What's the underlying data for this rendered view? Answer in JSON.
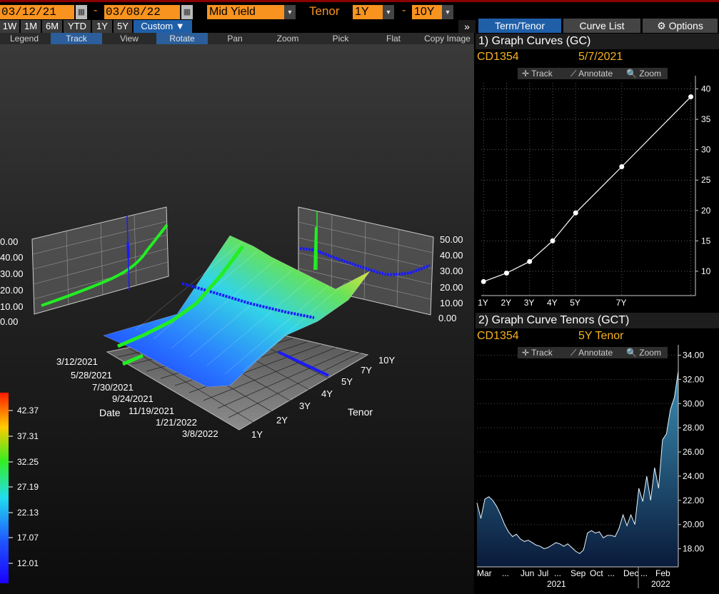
{
  "topbar": {
    "start_date": "03/12/21",
    "end_date": "03/08/22",
    "field": "Mid Yield",
    "tenor_label": "Tenor",
    "tenor_from": "1Y",
    "tenor_to": "10Y",
    "dash": "-",
    "calendar_icon": "calendar-icon",
    "dropdown_icon": "chevron-down-icon"
  },
  "periods": [
    "1W",
    "1M",
    "6M",
    "YTD",
    "1Y",
    "5Y",
    "Custom ▼"
  ],
  "toolbar": [
    "Legend",
    "Track",
    "View",
    "Rotate",
    "Pan",
    "Zoom",
    "Pick",
    "Flat",
    "Copy Image"
  ],
  "toolbar_active": [
    "Track",
    "Rotate"
  ],
  "collapse_label": "»",
  "right_tabs": [
    {
      "label": "Term/Tenor",
      "active": true
    },
    {
      "label": "Curve List",
      "active": false
    },
    {
      "label": "⚙ Options",
      "active": false
    }
  ],
  "gc": {
    "title": "1) Graph Curves (GC)",
    "ticker": "CD1354",
    "date": "5/7/2021",
    "tools": [
      "✛ Track",
      "⟋ Annotate",
      "🔍 Zoom"
    ],
    "chart_data": {
      "type": "line",
      "x": [
        "1Y",
        "2Y",
        "3Y",
        "4Y",
        "5Y",
        "7Y",
        "10Y"
      ],
      "x_pos": [
        1,
        2,
        3,
        4,
        5,
        7,
        10
      ],
      "xlabels": [
        "1Y",
        "2Y",
        "3Y",
        "4Y",
        "5Y",
        "7Y"
      ],
      "values": [
        8.3,
        9.7,
        11.6,
        15.0,
        19.6,
        27.2,
        38.7
      ],
      "ylim": [
        6,
        41
      ],
      "yticks": [
        10,
        15,
        20,
        25,
        30,
        35,
        40
      ],
      "grid": true,
      "color": "#ffffff"
    }
  },
  "gct": {
    "title": "2) Graph Curve Tenors (GCT)",
    "ticker": "CD1354",
    "tenor": "5Y Tenor",
    "tools": [
      "✛ Track",
      "⟋ Annotate",
      "🔍 Zoom"
    ],
    "chart_data": {
      "type": "area",
      "xlabels": [
        "Mar",
        "...",
        "Jun",
        "Jul",
        "...",
        "Sep",
        "Oct",
        "...",
        "Dec",
        "...",
        "Feb"
      ],
      "year_labels": [
        "2021",
        "2022"
      ],
      "values": [
        21.8,
        20.5,
        22.1,
        22.3,
        22.0,
        21.5,
        20.8,
        20.0,
        19.4,
        19.0,
        19.2,
        18.8,
        18.6,
        18.7,
        18.5,
        18.3,
        18.2,
        18.0,
        18.1,
        18.3,
        18.5,
        18.4,
        18.2,
        18.4,
        18.1,
        17.8,
        17.6,
        17.9,
        19.3,
        19.5,
        19.3,
        19.4,
        18.9,
        19.1,
        19.1,
        19.0,
        19.7,
        20.8,
        19.9,
        20.8,
        20.0,
        23.0,
        21.9,
        24.0,
        22.0,
        24.7,
        23.0,
        27.0,
        27.5,
        29.5,
        30.5,
        32.7
      ],
      "ylim": [
        16.5,
        34.5
      ],
      "yticks": [
        18,
        20,
        22,
        24,
        26,
        28,
        30,
        32,
        34
      ],
      "grid": true,
      "color": "#3a8fb5"
    }
  },
  "surface": {
    "chart_data": {
      "type": "heatmap",
      "x_axis": "Date",
      "y_axis": "Tenor",
      "dates": [
        "3/12/2021",
        "5/28/2021",
        "7/30/2021",
        "9/24/2021",
        "11/19/2021",
        "1/21/2022",
        "3/8/2022"
      ],
      "tenors": [
        "1Y",
        "2Y",
        "3Y",
        "4Y",
        "5Y",
        "7Y",
        "10Y"
      ],
      "side_ticks": [
        "0.00",
        "10.00",
        "20.00",
        "30.00",
        "40.00",
        "50.00"
      ],
      "left_ticks_visible": [
        "0.00",
        "10.00",
        "20.00",
        "30.00",
        "40.00",
        "0.00"
      ],
      "colorbar": [
        "42.37",
        "37.31",
        "32.25",
        "27.19",
        "22.13",
        "17.07",
        "12.01"
      ]
    }
  }
}
